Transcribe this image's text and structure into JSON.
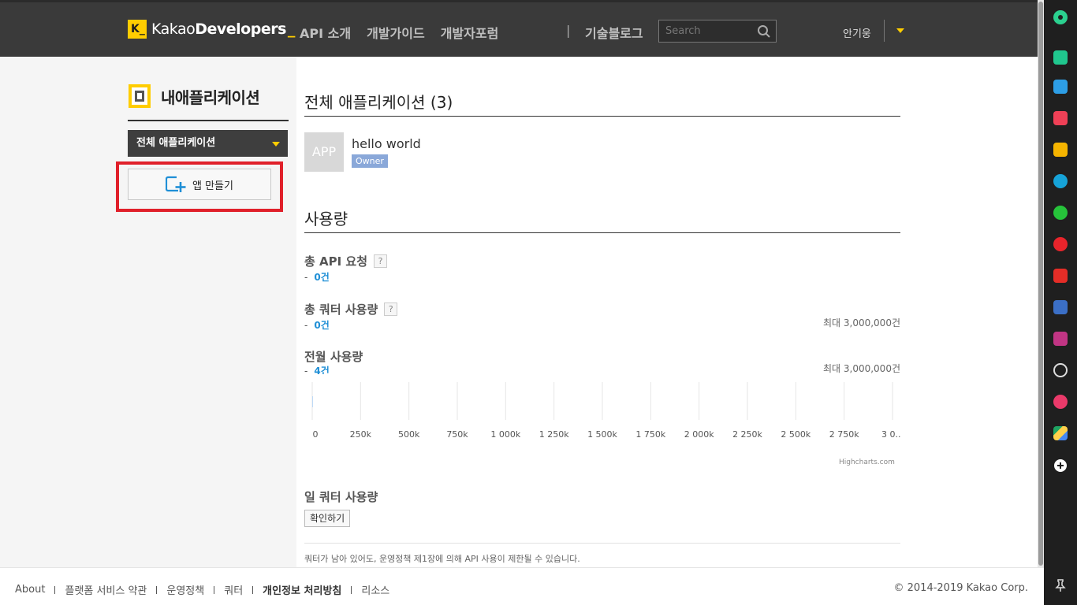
{
  "header": {
    "logo_box": "K_",
    "logo_kakao": "Kakao",
    "logo_developers": "Developers",
    "logo_underscore": "_",
    "nav": [
      "API 소개",
      "개발가이드",
      "개발자포럼"
    ],
    "nav_sep": "|",
    "nav_blog": "기술블로그",
    "search_placeholder": "Search",
    "user_name": "안기웅"
  },
  "sidebar": {
    "title": "내애플리케이션",
    "select_label": "전체 애플리케이션",
    "create_button": "앱 만들기"
  },
  "main": {
    "apps_heading": "전체 애플리케이션 (3)",
    "app": {
      "thumb_label": "APP",
      "name": "hello world",
      "role": "Owner"
    },
    "usage_heading": "사용량",
    "stats": [
      {
        "label": "총 API 요청",
        "help": "?",
        "dash": "-",
        "value": "0건",
        "max": ""
      },
      {
        "label": "총 쿼터 사용량",
        "help": "?",
        "dash": "-",
        "value": "0건",
        "max": "최대 3,000,000건"
      },
      {
        "label": "전월 사용량",
        "help": "",
        "dash": "-",
        "value": "4건",
        "max": "최대 3,000,000건"
      }
    ],
    "credits": "Highcharts.com",
    "daily_heading": "일 쿼터 사용량",
    "check_button": "확인하기",
    "note": "쿼터가 남아 있어도, 운영정책 제1장에 의해 API 사용이 제한될 수 있습니다."
  },
  "chart_data": {
    "type": "bar",
    "title": "",
    "xlabel": "",
    "ylabel": "",
    "tick_labels": [
      "0",
      "250k",
      "500k",
      "750k",
      "1 000k",
      "1 250k",
      "1 500k",
      "1 750k",
      "2 000k",
      "2 250k",
      "2 500k",
      "2 750k",
      "3 0..."
    ],
    "xlim": [
      0,
      3000000
    ],
    "values": [
      4
    ],
    "grid": true
  },
  "footer": {
    "links": [
      "About",
      "플랫폼 서비스 약관",
      "운영정책",
      "쿼터",
      "개인정보 처리방침",
      "리소스"
    ],
    "copyright": "© 2014-2019 Kakao Corp."
  },
  "colors": {
    "accent": "#ffcd00",
    "header_bg": "#3a3a3a",
    "highlight": "#e0202a",
    "value_blue": "#1f8fd6",
    "badge_blue": "#8aa8d9"
  },
  "dock_icons": [
    "circle-app-icon",
    "bell-icon",
    "inbox-icon",
    "pocket-icon",
    "star-icon",
    "edge-icon",
    "square-app-icon",
    "music-icon",
    "youtube-icon",
    "facebook-icon",
    "instagram-icon",
    "clock-icon",
    "dribbble-icon",
    "drive-icon",
    "plus-icon",
    "pin-icon"
  ]
}
